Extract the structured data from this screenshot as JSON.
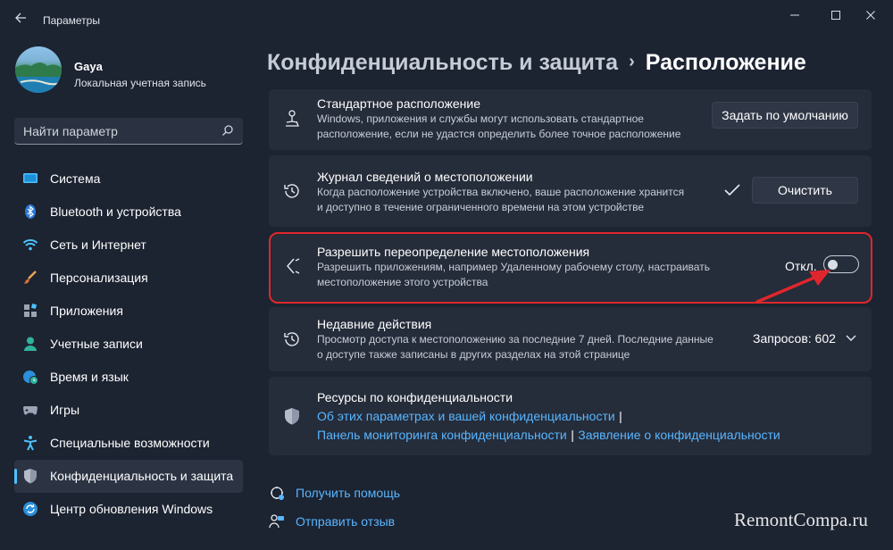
{
  "window": {
    "title": "Параметры",
    "controls": [
      "minimize-icon",
      "maximize-icon",
      "close-icon"
    ]
  },
  "user": {
    "name": "Gaya",
    "account_type": "Локальная учетная запись"
  },
  "search": {
    "placeholder": "Найти параметр",
    "icon": "search-icon"
  },
  "sidebar": {
    "items": [
      {
        "label": "Система",
        "icon": "system-icon",
        "active": false
      },
      {
        "label": "Bluetooth и устройства",
        "icon": "bluetooth-icon",
        "active": false
      },
      {
        "label": "Сеть и Интернет",
        "icon": "wifi-icon",
        "active": false
      },
      {
        "label": "Персонализация",
        "icon": "brush-icon",
        "active": false
      },
      {
        "label": "Приложения",
        "icon": "apps-icon",
        "active": false
      },
      {
        "label": "Учетные записи",
        "icon": "account-icon",
        "active": false
      },
      {
        "label": "Время и язык",
        "icon": "globe-clock-icon",
        "active": false
      },
      {
        "label": "Игры",
        "icon": "gamepad-icon",
        "active": false
      },
      {
        "label": "Специальные возможности",
        "icon": "accessibility-icon",
        "active": false
      },
      {
        "label": "Конфиденциальность и защита",
        "icon": "shield-icon",
        "active": true
      },
      {
        "label": "Центр обновления Windows",
        "icon": "update-icon",
        "active": false
      }
    ]
  },
  "breadcrumb": {
    "parent": "Конфиденциальность и защита",
    "separator": "›",
    "current": "Расположение"
  },
  "cards": {
    "default_location": {
      "title": "Стандартное расположение",
      "description_line1": "Windows, приложения и службы могут использовать стандартное",
      "description_line2": "расположение, если не удастся определить более точное расположение",
      "button": "Задать по умолчанию"
    },
    "location_history": {
      "title": "Журнал сведений о местоположении",
      "description_line1": "Когда расположение устройства включено, ваше расположение хранится",
      "description_line2": "и доступно в течение ограниченного времени на этом устройстве",
      "check": "✓",
      "button": "Очистить"
    },
    "override": {
      "title": "Разрешить переопределение местоположения",
      "description_line1": "Разрешить приложениям, например Удаленному рабочему столу, настраивать",
      "description_line2": "местоположение этого устройства",
      "toggle_label": "Откл.",
      "toggle_state": "off"
    },
    "recent": {
      "title": "Недавние действия",
      "description_line1": "Просмотр доступа к местоположению за последние 7 дней. Последние данные",
      "description_line2": "о доступе также записаны в других разделах на этой странице",
      "requests": "Запросов: 602"
    },
    "resources": {
      "title": "Ресурсы по конфиденциальности",
      "link1": "Об этих параметрах и вашей конфиденциальности",
      "link2": "Панель мониторинга конфиденциальности",
      "link3": "Заявление о конфиденциальности",
      "pipe": "|"
    }
  },
  "footer": {
    "help": "Получить помощь",
    "feedback": "Отправить отзыв"
  },
  "watermark": "RemontCompa.ru",
  "colors": {
    "background": "#1c2331",
    "card": "#252c3a",
    "accent": "#4cc2ff",
    "link": "#59b6ff",
    "highlight": "#e0262d"
  }
}
